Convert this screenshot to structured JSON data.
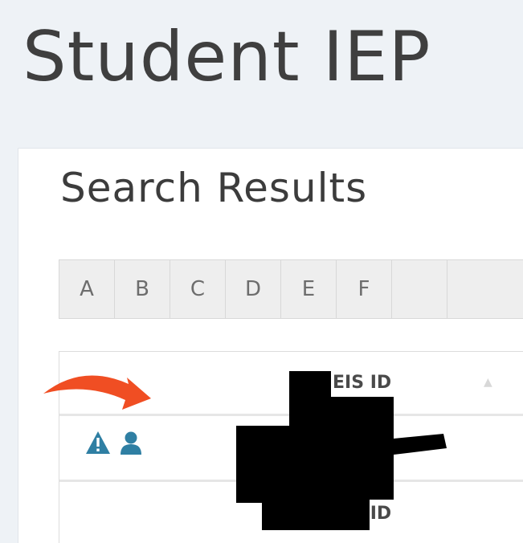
{
  "page": {
    "title": "Student IEP"
  },
  "panel": {
    "title": "Search Results"
  },
  "alphabet": {
    "letters": [
      "A",
      "B",
      "C",
      "D",
      "E",
      "F"
    ]
  },
  "table": {
    "column_header": "EIS ID",
    "row_label": "EIS ID"
  },
  "icons": {
    "warning": "warning-triangle-icon",
    "student": "person-icon",
    "icon_color": "#2f7fa3",
    "arrow_color": "#f04e23"
  }
}
